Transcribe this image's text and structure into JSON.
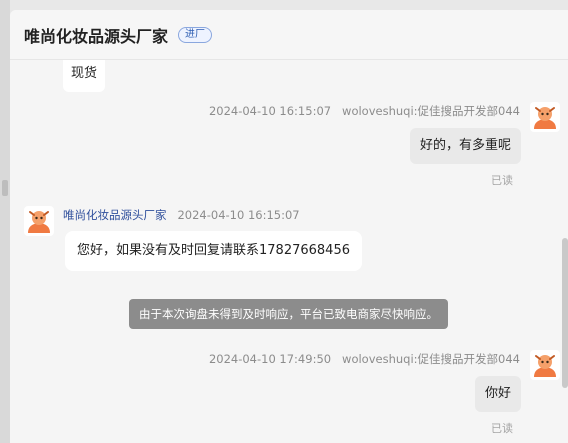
{
  "header": {
    "title": "唯尚化妆品源头厂家",
    "tag": "进厂"
  },
  "messages": [
    {
      "side": "left",
      "text": "现货"
    },
    {
      "side": "right",
      "timestamp": "2024-04-10 16:15:07",
      "sender": "woloveshuqi:促佳搜品开发部044",
      "text": "好的，有多重呢",
      "status": "已读"
    },
    {
      "side": "left",
      "sender": "唯尚化妆品源头厂家",
      "timestamp": "2024-04-10 16:15:07",
      "text": "您好，如果没有及时回复请联系17827668456"
    },
    {
      "side": "right",
      "timestamp": "2024-04-10 17:49:50",
      "sender": "woloveshuqi:促佳搜品开发部044",
      "text": "你好",
      "status": "已读"
    }
  ],
  "system_notice": "由于本次询盘未得到及时响应，平台已致电商家尽快响应。",
  "colors": {
    "avatar_bg": "#f07a42",
    "link": "#2f4f9c",
    "notice_bg": "#8c8c8c"
  }
}
